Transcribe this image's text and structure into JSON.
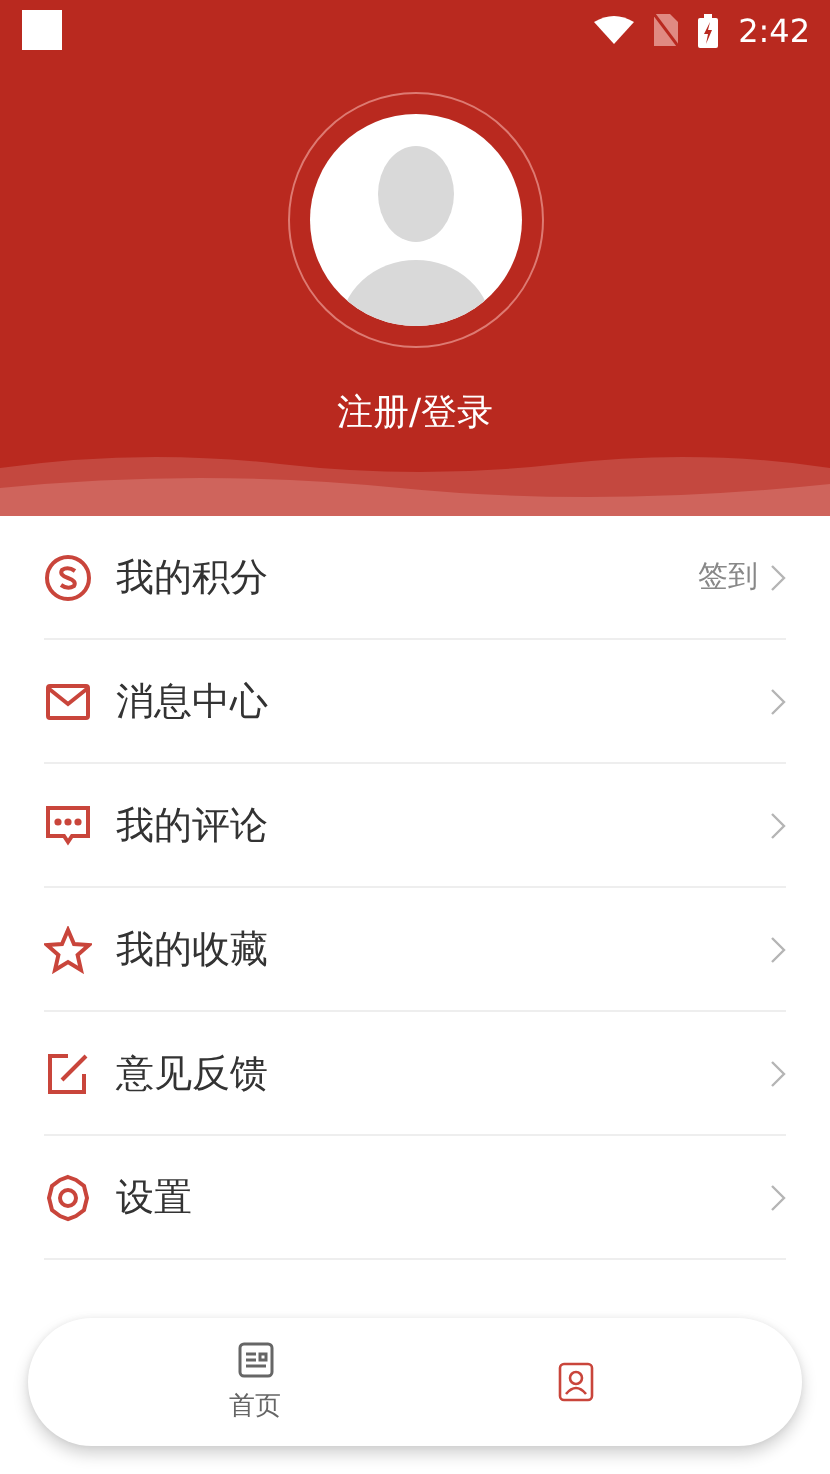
{
  "status_bar": {
    "time": "2:42"
  },
  "profile": {
    "login_label": "注册/登录"
  },
  "menu": [
    {
      "label": "我的积分",
      "action": "签到"
    },
    {
      "label": "消息中心"
    },
    {
      "label": "我的评论"
    },
    {
      "label": "我的收藏"
    },
    {
      "label": "意见反馈"
    },
    {
      "label": "设置"
    }
  ],
  "tab_bar": [
    {
      "label": "首页",
      "selected": false
    },
    {
      "selected": true
    }
  ]
}
